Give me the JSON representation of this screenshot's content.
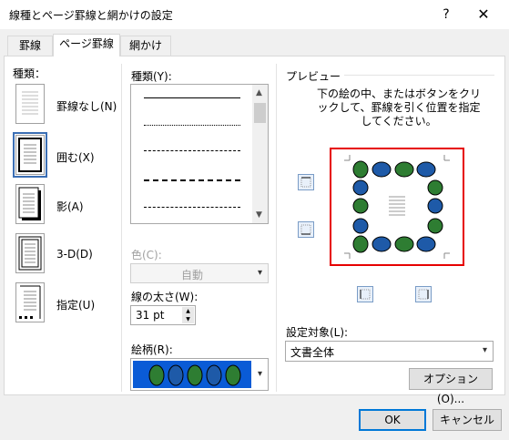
{
  "window": {
    "title": "線種とページ罫線と網かけの設定",
    "help_label": "?",
    "close_label": "✕"
  },
  "tabs": [
    {
      "label": "罫線",
      "active": false
    },
    {
      "label": "ページ罫線",
      "active": true
    },
    {
      "label": "網かけ",
      "active": false
    }
  ],
  "settings": {
    "header": "種類：",
    "items": [
      {
        "label": "罫線なし(N)",
        "selected": false
      },
      {
        "label": "囲む(X)",
        "selected": true
      },
      {
        "label": "影(A)",
        "selected": false
      },
      {
        "label": "3-D(D)",
        "selected": false
      },
      {
        "label": "指定(U)",
        "selected": false
      }
    ]
  },
  "style": {
    "header": "種類(Y):",
    "lines": [
      "solid",
      "dotted",
      "dashed-fine",
      "dashed",
      "dash-dot"
    ]
  },
  "color": {
    "label": "色(C):",
    "value": "自動",
    "disabled": true
  },
  "width": {
    "label": "線の太さ(W):",
    "value": "31 pt"
  },
  "art": {
    "label": "絵柄(R):"
  },
  "preview": {
    "header": "プレビュー",
    "instructions": "下の絵の中、またはボタンをクリックして、罫線を引く位置を指定してください。"
  },
  "apply_to": {
    "label": "設定対象(L):",
    "value": "文書全体"
  },
  "buttons": {
    "options": "オプション(O)...",
    "ok": "OK",
    "cancel": "キャンセル"
  },
  "colors": {
    "accent": "#0078d7",
    "selection_blue": "#0a5bd6",
    "preview_border": "#e60000",
    "gem_green": "#2e7d32",
    "gem_blue": "#1e5aa8"
  }
}
